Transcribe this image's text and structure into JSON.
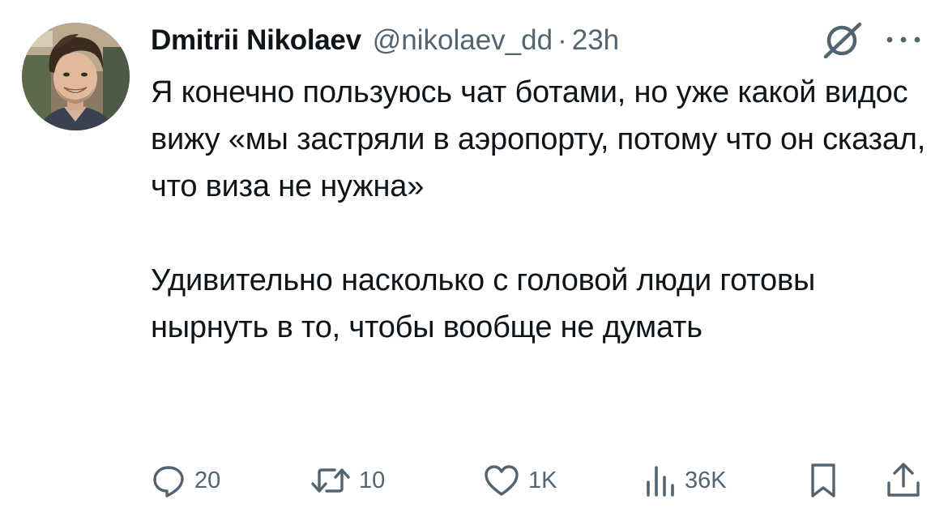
{
  "author": {
    "display_name": "Dmitrii Nikolaev",
    "handle": "@nikolaev_dd",
    "separator": "·",
    "time": "23h"
  },
  "tweet": {
    "paragraphs": [
      "Я конечно пользуюсь чат ботами, но уже какой видос вижу «мы застряли в аэропорту, потому что он сказал, что виза не нужна»",
      "Удивительно насколько с головой люди готовы нырнуть в то, чтобы вообще не думать"
    ]
  },
  "actions": {
    "replies": "20",
    "reposts": "10",
    "likes": "1K",
    "views": "36K"
  },
  "icons": {
    "grok": "grok-icon",
    "more": "more-icon",
    "reply": "reply-icon",
    "repost": "repost-icon",
    "like": "like-icon",
    "views": "views-icon",
    "bookmark": "bookmark-icon",
    "share": "share-icon"
  },
  "colors": {
    "text": "#0f1419",
    "secondary": "#536471"
  }
}
